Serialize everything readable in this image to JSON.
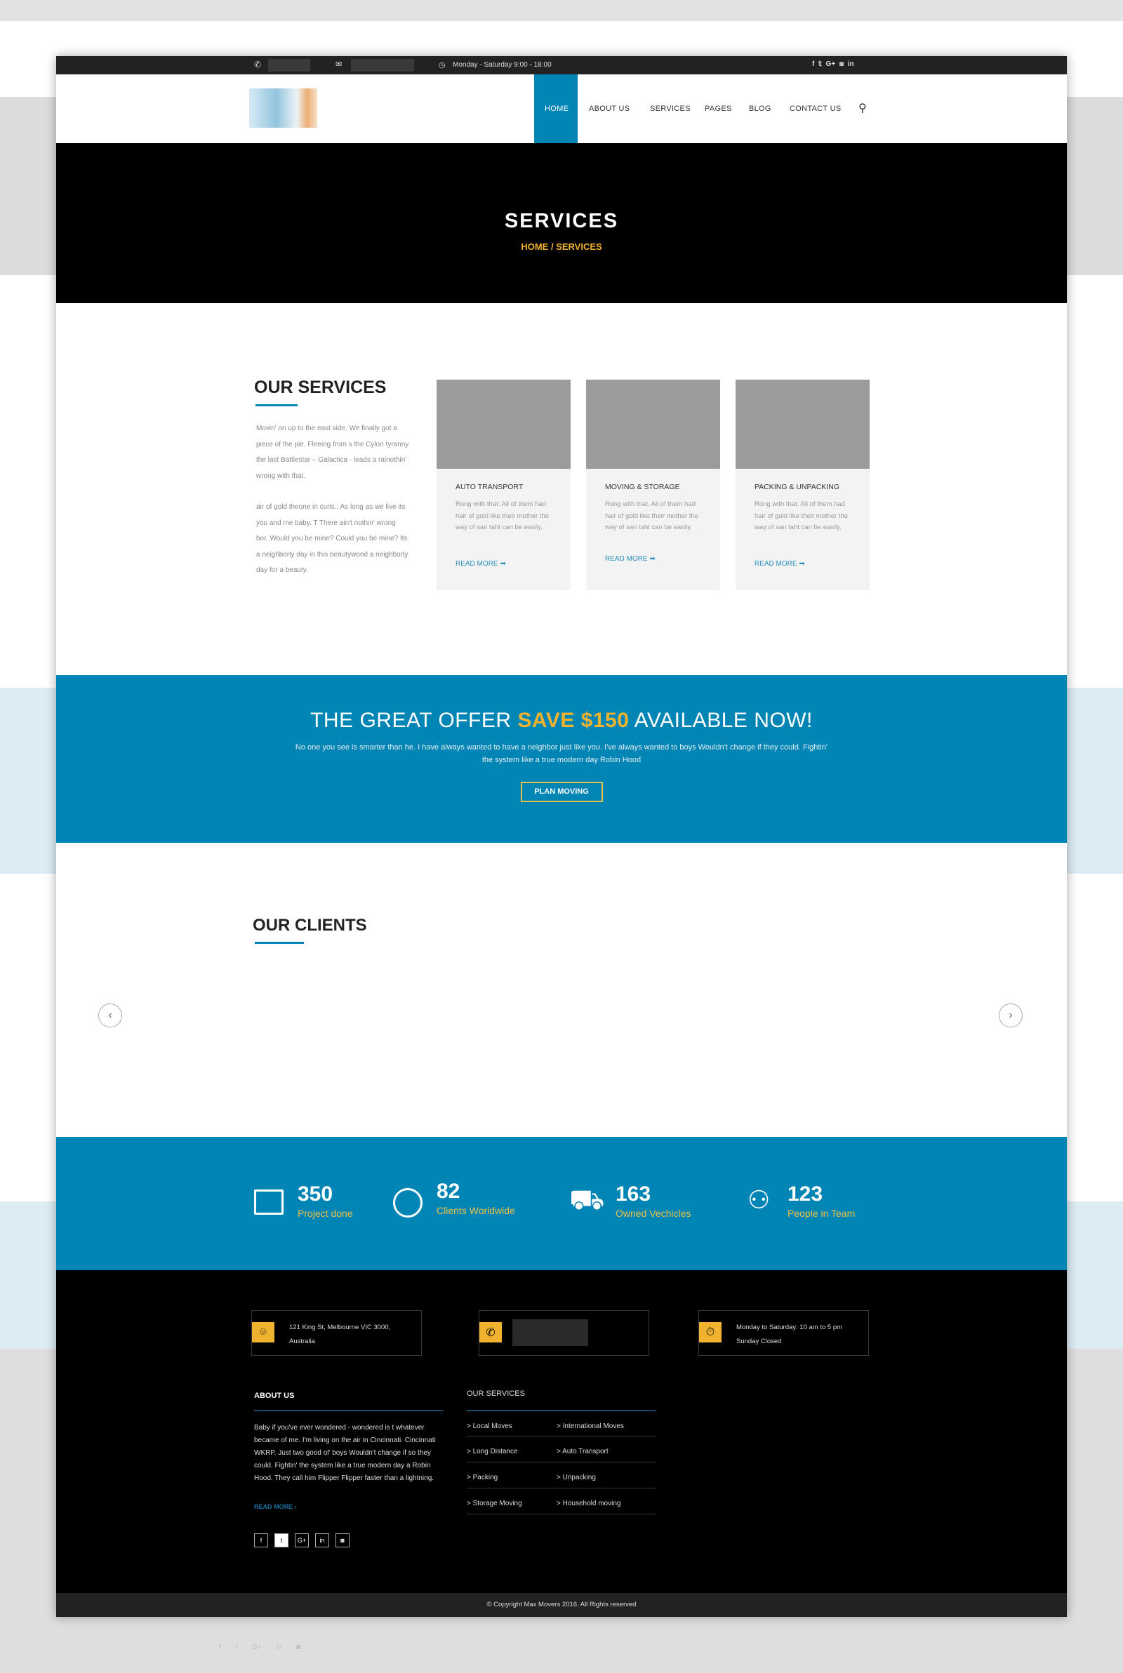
{
  "topbar": {
    "hours": "Monday - Saturday 9:00 - 18:00",
    "social": [
      "f",
      "t",
      "G+",
      "ig",
      "in"
    ]
  },
  "nav": {
    "items": [
      "HOME",
      "ABOUT US",
      "SERVICES",
      "PAGES",
      "BLOG",
      "CONTACT US"
    ],
    "active": "HOME"
  },
  "hero": {
    "title": "SERVICES",
    "breadcrumb": "HOME / SERVICES"
  },
  "services": {
    "title": "OUR SERVICES",
    "para1": "Movin' on up to the east side. We finally got a piece of the pie. Fleeing from s the Cylon tyranny the last Battlestar – Galactica - leads a rainothin' wrong with that.",
    "para2": "air of gold  theone in curls.; As long as we live its you and me baby. T There ain't nothin' wrong bor. Would you be mine? Could you be mine? Its a neighborly day in this beautywood a neighborly day for a beauty.",
    "cards": [
      {
        "title": "AUTO TRANSPORT",
        "text": "Rong with that. All of them had hair of gold like their mother the way of san taht can be easily.",
        "link": "READ MORE"
      },
      {
        "title": "MOVING & STORAGE",
        "text": "Rong with that. All of them had hair of gold like their mother the way of san taht can be easily.",
        "link": "READ MORE"
      },
      {
        "title": "PACKING & UNPACKING",
        "text": "Rong with that. All of them had hair of gold like their mother the way of san taht can be easily.",
        "link": "READ MORE"
      }
    ]
  },
  "offer": {
    "title_a": "THE GREAT OFFER ",
    "title_b": "SAVE $150",
    "title_c": " AVAILABLE NOW!",
    "text": "No one you see is smarter than he. I have always wanted to have a neighbor just like you. I've always wanted to  boys Wouldn't change if they could. Fightin' the system like a true modern day Robin Hood",
    "button": "PLAN MOVING"
  },
  "clients": {
    "title": "OUR CLIENTS"
  },
  "stats": [
    {
      "num": "350",
      "label": "Project done",
      "icon": "calendar-icon"
    },
    {
      "num": "82",
      "label": "Clients Worldwide",
      "icon": "globe-icon"
    },
    {
      "num": "163",
      "label": "Owned Vechicles",
      "icon": "truck-icon"
    },
    {
      "num": "123",
      "label": "People in Team",
      "icon": "people-icon"
    }
  ],
  "footer": {
    "address": [
      "121 King St, Melbourne VIC 3000,",
      "Australia"
    ],
    "hours": [
      "Monday to Saturday: 10 am to 5 pm",
      "Sunday Closed"
    ],
    "about_title": "ABOUT US",
    "about_text": "Baby if you've ever wondered - wondered is t whatever became of me. I'm living on the air in Cincinnati. Cincinnati WKRP. Just two good ol' boys Wouldn't change if so they could. Fightin' the system like a true modern day a Robin Hood. They call him Flipper Flipper faster than a lightning.",
    "about_link": "READ MORE",
    "services_title": "OUR SERVICES",
    "services": [
      "Local Moves",
      "International Moves",
      "Long Distance",
      "Auto Transport",
      "Packing",
      "Unpacking",
      "Storage Moving",
      "Household moving"
    ],
    "social": [
      "f",
      "t",
      "G+",
      "in",
      "ig"
    ],
    "copyright": "© Copyright Max Movers 2016. All Rights reserved"
  },
  "colors": {
    "accent": "#0085b5",
    "highlight": "#f0b32f"
  }
}
